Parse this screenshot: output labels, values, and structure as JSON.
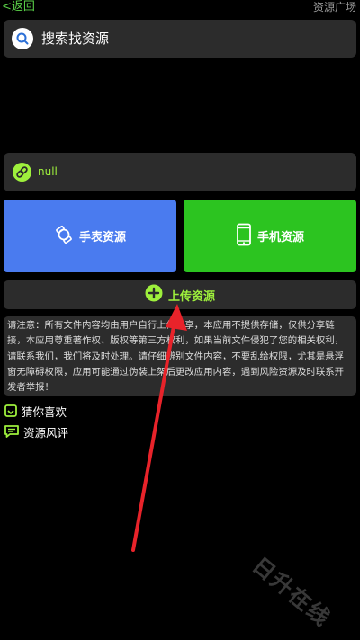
{
  "header": {
    "back_label": "<返回",
    "title": "资源广场"
  },
  "search": {
    "label": "搜索找资源",
    "icon": "search-icon"
  },
  "null_card": {
    "label": "null",
    "icon": "link-icon"
  },
  "tiles": {
    "watch": {
      "label": "手表资源",
      "icon": "watch-icon",
      "color": "#4a7bef"
    },
    "phone": {
      "label": "手机资源",
      "icon": "phone-icon",
      "color": "#2cc420"
    }
  },
  "upload": {
    "label": "上传资源",
    "icon": "plus-circle-icon",
    "color": "#9ef03c"
  },
  "notice": {
    "text": "请注意：所有文件内容均由用户自行上传分享，本应用不提供存储，仅供分享链接，本应用尊重著作权、版权等第三方权利，如果当前文件侵犯了您的相关权利，请联系我们，我们将及时处理。请仔细辨别文件内容，不要乱给权限，尤其是悬浮窗无障碍权限，应用可能通过伪装上架后更改应用内容，遇到风险资源及时联系开发者举报！"
  },
  "list": [
    {
      "label": "猜你喜欢",
      "icon": "guess-icon"
    },
    {
      "label": "资源风评",
      "icon": "comment-icon"
    }
  ],
  "watermark": "日升在线",
  "annotation": {
    "arrow_color": "#e8232a"
  }
}
